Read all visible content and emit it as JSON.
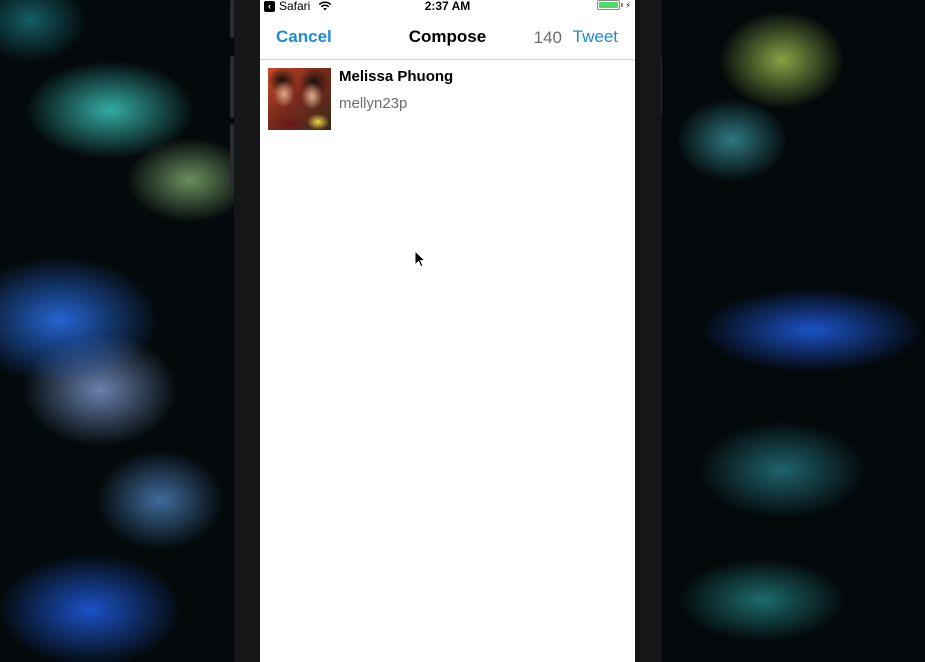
{
  "status_bar": {
    "back_app": "Safari",
    "time": "2:37 AM",
    "battery_percent": 100,
    "back_icon": "chevron-left-icon",
    "wifi_icon": "wifi-icon",
    "battery_icon": "battery-icon",
    "charging_icon": "bolt-icon"
  },
  "nav": {
    "cancel_label": "Cancel",
    "title": "Compose",
    "char_count": "140",
    "tweet_label": "Tweet"
  },
  "user": {
    "name": "Melissa Phuong",
    "handle": "mellyn23p"
  },
  "colors": {
    "accent": "#1a8cd8",
    "secondary_text": "#6d6d72",
    "battery_green": "#4cd964"
  }
}
